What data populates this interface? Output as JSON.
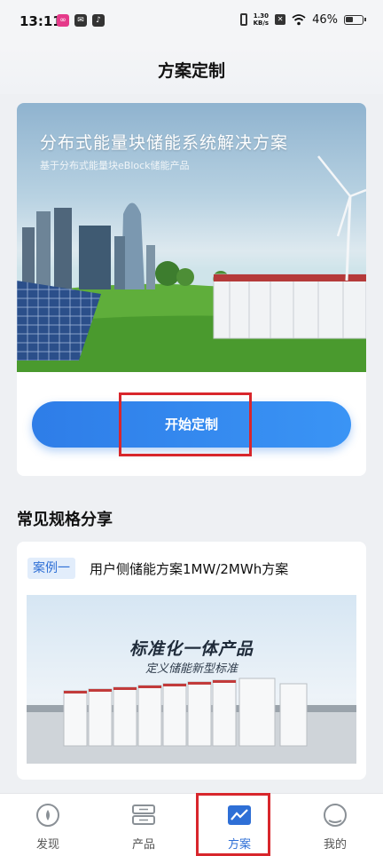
{
  "status_bar": {
    "time": "13:11",
    "net_speed_value": "1.30",
    "net_speed_unit": "KB/s",
    "battery": "46%"
  },
  "header": {
    "title": "方案定制"
  },
  "hero": {
    "title": "分布式能量块储能系统解决方案",
    "subtitle": "基于分布式能量块eBlock储能产品",
    "start_button": "开始定制"
  },
  "section": {
    "title": "常见规格分享"
  },
  "case": {
    "tag": "案例一",
    "title": "用户侧储能方案1MW/2MWh方案",
    "slogan": "标准化一体产品",
    "slogan_sub": "定义储能新型标准"
  },
  "bottom_nav": [
    {
      "label": "发现",
      "icon": "discover-icon",
      "active": false
    },
    {
      "label": "产品",
      "icon": "product-icon",
      "active": false
    },
    {
      "label": "方案",
      "icon": "solution-icon",
      "active": true
    },
    {
      "label": "我的",
      "icon": "profile-icon",
      "active": false
    }
  ],
  "colors": {
    "accent": "#2e7de8",
    "highlight_box": "#d8262c",
    "tag_bg": "#e2edfb"
  }
}
